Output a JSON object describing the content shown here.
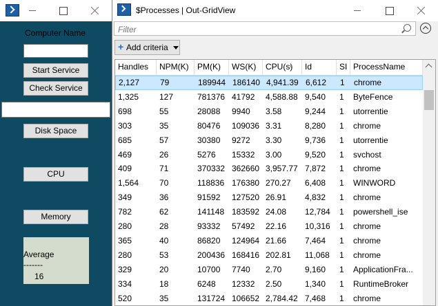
{
  "left_window": {
    "title": "",
    "form": {
      "computer_name_label": "Computer Name",
      "computer_name_value": "",
      "start_service": "Start Service",
      "check_service": "Check Service",
      "service_output": "",
      "disk_space": "Disk Space",
      "cpu": "CPU",
      "memory": "Memory",
      "average_label": "Average",
      "average_separator": "-------",
      "average_value": "16"
    }
  },
  "grid_window": {
    "title": "$Processes |  Out-GridView",
    "filter_placeholder": "Filter",
    "add_criteria": "Add criteria",
    "columns": [
      "Handles",
      "NPM(K)",
      "PM(K)",
      "WS(K)",
      "CPU(s)",
      "Id",
      "SI",
      "ProcessName"
    ],
    "sorted_column": "CPU(s)",
    "selected_row": 0,
    "rows": [
      [
        "2,127",
        "79",
        "189944",
        "186140",
        "4,941.39",
        "6,612",
        "1",
        "chrome"
      ],
      [
        "1,325",
        "127",
        "781376",
        "41792",
        "4,588.88",
        "9,540",
        "1",
        "ByteFence"
      ],
      [
        "698",
        "55",
        "28088",
        "9940",
        "3.58",
        "9,244",
        "1",
        "utorrentie"
      ],
      [
        "303",
        "35",
        "80476",
        "109036",
        "3.31",
        "8,280",
        "1",
        "chrome"
      ],
      [
        "685",
        "57",
        "30380",
        "9272",
        "3.30",
        "9,736",
        "1",
        "utorrentie"
      ],
      [
        "469",
        "26",
        "5276",
        "15332",
        "3.00",
        "9,520",
        "1",
        "svchost"
      ],
      [
        "409",
        "71",
        "370332",
        "362660",
        "3,957.77",
        "7,872",
        "1",
        "chrome"
      ],
      [
        "1,564",
        "70",
        "118836",
        "176380",
        "270.27",
        "6,408",
        "1",
        "WINWORD"
      ],
      [
        "349",
        "36",
        "91592",
        "127520",
        "26.91",
        "4,832",
        "1",
        "chrome"
      ],
      [
        "782",
        "62",
        "141148",
        "183592",
        "24.08",
        "12,784",
        "1",
        "powershell_ise"
      ],
      [
        "280",
        "28",
        "93332",
        "57492",
        "22.16",
        "10,316",
        "1",
        "chrome"
      ],
      [
        "365",
        "40",
        "86820",
        "124964",
        "21.66",
        "7,464",
        "1",
        "chrome"
      ],
      [
        "280",
        "53",
        "200436",
        "168416",
        "202.81",
        "11,068",
        "1",
        "chrome"
      ],
      [
        "329",
        "20",
        "10700",
        "7740",
        "2.70",
        "9,160",
        "1",
        "ApplicationFra..."
      ],
      [
        "334",
        "18",
        "6248",
        "12332",
        "2.50",
        "1,340",
        "1",
        "RuntimeBroker"
      ],
      [
        "520",
        "35",
        "131724",
        "106652",
        "2,784.42",
        "7,468",
        "1",
        "chrome"
      ]
    ]
  },
  "colors": {
    "form_background": "#0f4a63",
    "selection": "#cce8ff",
    "average_panel": "#d4dccd"
  }
}
